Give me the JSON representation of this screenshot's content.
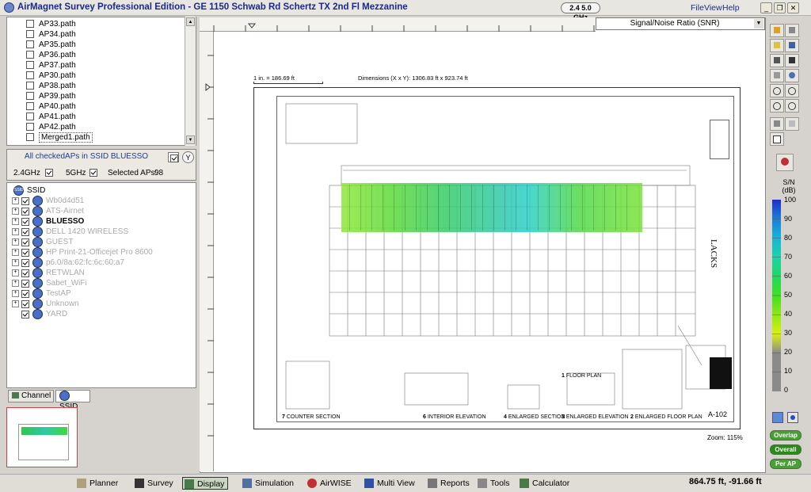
{
  "app": {
    "title": "AirMagnet Survey Professional Edition - GE 1150 Schwab Rd Schertz TX 2nd Fl Mezzanine",
    "band_badge": "2.4 5.0 GHz",
    "menu": [
      "File",
      "View",
      "Help"
    ]
  },
  "paths": {
    "items": [
      "AP33.path",
      "AP34.path",
      "AP35.path",
      "AP36.path",
      "AP37.path",
      "AP30.path",
      "AP38.path",
      "AP39.path",
      "AP40.path",
      "AP41.path",
      "AP42.path",
      "Merged1.path"
    ]
  },
  "ssid_panel": {
    "header": "All checkedAPs in SSID BLUESSO",
    "band1": "2.4GHz",
    "band2": "5GHz",
    "selected_label": "Selected APs:",
    "selected_count": "98",
    "root": "SSID",
    "items": [
      {
        "name": "Wb0d4d51",
        "faded": true
      },
      {
        "name": "ATS-Airnet",
        "faded": true
      },
      {
        "name": "BLUESSO",
        "faded": false,
        "bold": true
      },
      {
        "name": "DELL 1420 WIRELESS",
        "faded": true
      },
      {
        "name": "GUEST",
        "faded": true
      },
      {
        "name": "HP Print-21-Officejet Pro 8600",
        "faded": true
      },
      {
        "name": "p6.0/8a:62:fc:6c:60:a7",
        "faded": true
      },
      {
        "name": "RETWLAN",
        "faded": true
      },
      {
        "name": "Sabet_WiFi",
        "faded": true
      },
      {
        "name": "TestAP",
        "faded": true
      },
      {
        "name": "Unknown",
        "faded": true
      },
      {
        "name": "YARD",
        "faded": true
      }
    ]
  },
  "tabs": {
    "channel": "Channel",
    "ssid": "SSID"
  },
  "view": {
    "mode": "Signal/Noise Ratio (SNR)",
    "scale": "1 in. = 186.69 ft",
    "dimensions": "Dimensions (X x Y): 1306.83 ft x 923.74 ft",
    "zoom": "Zoom: 115%"
  },
  "drawing": {
    "company": "LACKS",
    "sheet": "A-102",
    "sections": [
      {
        "num": "7",
        "label": "COUNTER SECTION"
      },
      {
        "num": "6",
        "label": "INTERIOR ELEVATION"
      },
      {
        "num": "4",
        "label": "ENLARGED SECTION"
      },
      {
        "num": "3",
        "label": "ENLARGED ELEVATION"
      },
      {
        "num": "2",
        "label": "ENLARGED FLOOR PLAN"
      },
      {
        "num": "1",
        "label": "FLOOR PLAN"
      }
    ]
  },
  "legend": {
    "unit_line1": "S/N",
    "unit_line2": "(dB)",
    "ticks": [
      "100",
      "90",
      "80",
      "70",
      "60",
      "50",
      "40",
      "30",
      "20",
      "10",
      "0"
    ],
    "colors": [
      "#1e2fc8",
      "#1a7fd8",
      "#18b4d8",
      "#1ad4a8",
      "#20d860",
      "#40e020",
      "#90e818",
      "#d8f010",
      "#8a8a8a",
      "#8a8a8a",
      "#8a8a8a"
    ]
  },
  "right_buttons": {
    "overlap": "Overlap",
    "overall": "Overall",
    "per_ap": "Per AP"
  },
  "bottom_tabs": [
    "Planner",
    "Survey",
    "Display",
    "Simulation",
    "AirWISE",
    "Multi View",
    "Reports",
    "Tools",
    "Calculator"
  ],
  "coords": "864.75 ft, -91.66 ft"
}
